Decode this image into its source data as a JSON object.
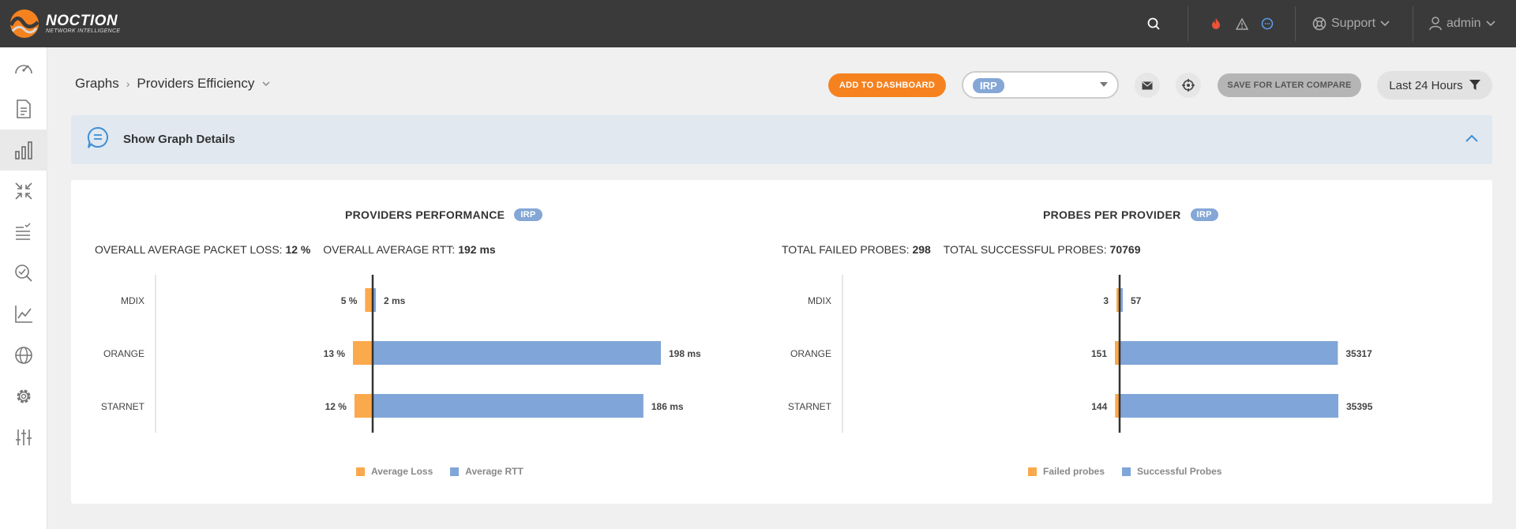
{
  "app": {
    "logo_name": "NOCTION",
    "logo_sub": "NETWORK INTELLIGENCE"
  },
  "topbar": {
    "support_label": "Support",
    "user_label": "admin"
  },
  "breadcrumb": {
    "root": "Graphs",
    "current": "Providers Efficiency"
  },
  "toolbar": {
    "add_dashboard_label": "ADD TO DASHBOARD",
    "select_value": "IRP",
    "save_compare_label": "SAVE FOR LATER COMPARE",
    "time_range_label": "Last 24 Hours"
  },
  "details": {
    "label": "Show Graph Details"
  },
  "colors": {
    "orange": "#fba94d",
    "blue": "#80a6d9",
    "accent": "#f5821f"
  },
  "panels": {
    "performance": {
      "title": "PROVIDERS PERFORMANCE",
      "badge": "IRP",
      "stat1_label": "OVERALL AVERAGE PACKET LOSS:",
      "stat1_value": "12 %",
      "stat2_label": "OVERALL AVERAGE RTT:",
      "stat2_value": "192 ms",
      "legend_left": "Average Loss",
      "legend_right": "Average RTT"
    },
    "probes": {
      "title": "PROBES PER PROVIDER",
      "badge": "IRP",
      "stat1_label": "TOTAL FAILED PROBES:",
      "stat1_value": "298",
      "stat2_label": "TOTAL SUCCESSFUL PROBES:",
      "stat2_value": "70769",
      "legend_left": "Failed probes",
      "legend_right": "Successful Probes"
    }
  },
  "chart_data": [
    {
      "type": "bar",
      "categories": [
        "MDIX",
        "ORANGE",
        "STARNET"
      ],
      "series": [
        {
          "name": "Average Loss",
          "values": [
            5,
            13,
            12
          ],
          "labels": [
            "5 %",
            "13 %",
            "12 %"
          ]
        },
        {
          "name": "Average RTT",
          "values": [
            2,
            198,
            186
          ],
          "labels": [
            "2 ms",
            "198 ms",
            "186 ms"
          ]
        }
      ],
      "legend": "bottom"
    },
    {
      "type": "bar",
      "categories": [
        "MDIX",
        "ORANGE",
        "STARNET"
      ],
      "series": [
        {
          "name": "Failed probes",
          "values": [
            3,
            151,
            144
          ],
          "labels": [
            "3",
            "151",
            "144"
          ]
        },
        {
          "name": "Successful Probes",
          "values": [
            57,
            35317,
            35395
          ],
          "labels": [
            "57",
            "35317",
            "35395"
          ]
        }
      ],
      "legend": "bottom"
    }
  ]
}
